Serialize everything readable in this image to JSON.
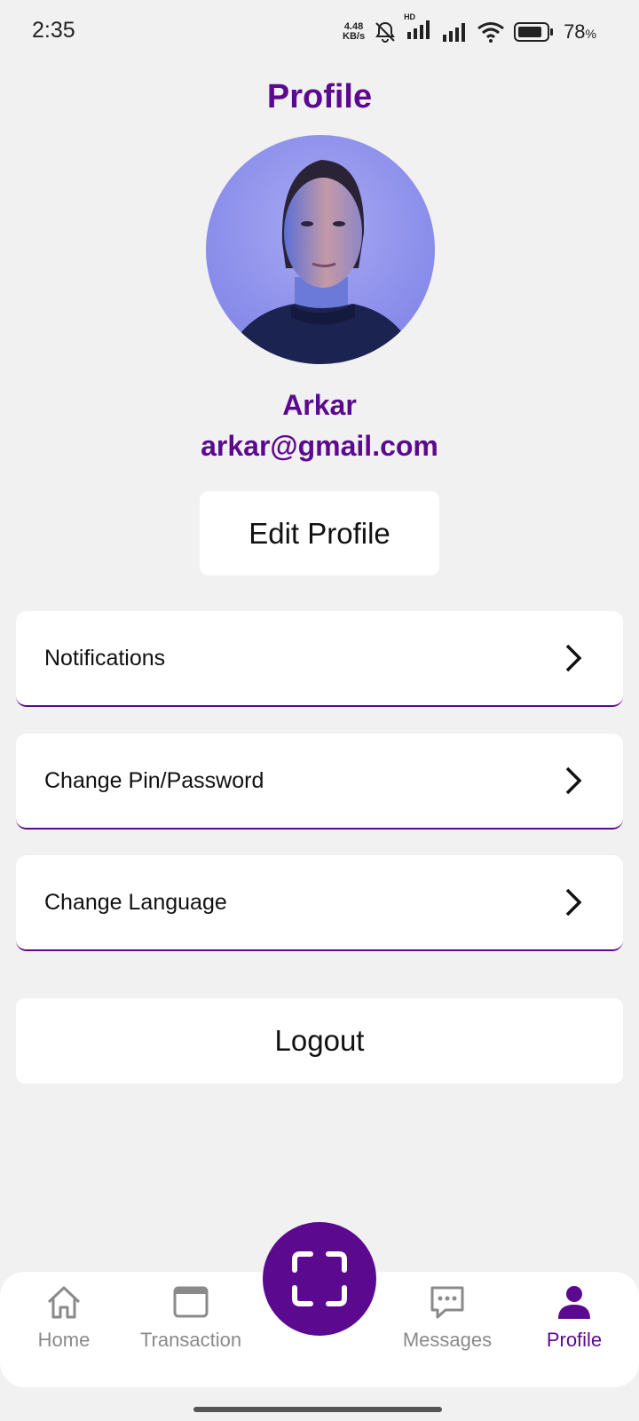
{
  "status_bar": {
    "time": "2:35",
    "net_speed_value": "4.48",
    "net_speed_unit": "KB/s",
    "hd_label": "HD",
    "battery_percent": "78",
    "battery_suffix": "%"
  },
  "page": {
    "title": "Profile"
  },
  "profile": {
    "name": "Arkar",
    "email": "arkar@gmail.com",
    "edit_button": "Edit Profile"
  },
  "menu": {
    "items": [
      {
        "label": "Notifications",
        "icon": "chevron-right-icon"
      },
      {
        "label": "Change Pin/Password",
        "icon": "chevron-right-icon"
      },
      {
        "label": "Change Language",
        "icon": "chevron-right-icon"
      }
    ],
    "logout": "Logout"
  },
  "bottom_nav": {
    "items": [
      {
        "label": "Home",
        "icon": "home-icon"
      },
      {
        "label": "Transaction",
        "icon": "window-icon"
      },
      {
        "label": "Messages",
        "icon": "chat-icon"
      },
      {
        "label": "Profile",
        "icon": "person-icon",
        "active": true
      }
    ],
    "center_icon": "scan-icon"
  },
  "colors": {
    "accent": "#5b0a8f",
    "background": "#f1f1f1",
    "card": "#ffffff",
    "inactive_nav": "#8a8a8a"
  }
}
